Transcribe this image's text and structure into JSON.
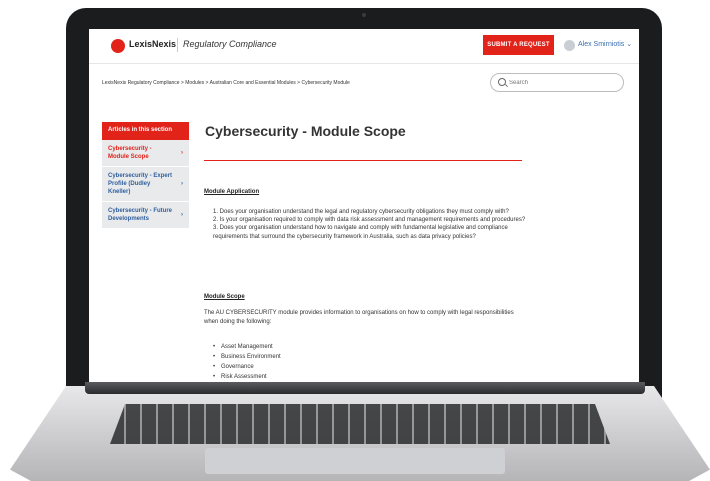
{
  "header": {
    "brand": "LexisNexis",
    "product": "Regulatory Compliance",
    "submit_button": "SUBMIT A REQUEST",
    "user_name": "Alex Smirniotis ⌄"
  },
  "breadcrumb": [
    "LexisNexis Regulatory Compliance",
    "Modules",
    "Australian Core and Essential Modules",
    "Cybersecurity Module"
  ],
  "breadcrumb_sep": " > ",
  "search": {
    "placeholder": "Search",
    "value": ""
  },
  "sidebar": {
    "header": "Articles in this section",
    "items": [
      {
        "label": "Cybersecurity - Module Scope",
        "active": true
      },
      {
        "label": "Cybersecurity - Expert Profile (Dudley Kneller)",
        "active": false
      },
      {
        "label": "Cybersecurity - Future Developments",
        "active": false
      }
    ],
    "chevron": "›"
  },
  "article": {
    "title": "Cybersecurity - Module Scope",
    "application_heading": "Module Application",
    "questions": [
      "1. Does your organisation understand the legal and regulatory cybersecurity obligations they must comply with?",
      "2. Is your organisation required to comply with data risk assessment and management requirements and procedures?",
      "3. Does your organisation understand how to navigate and comply with fundamental legislative and compliance requirements that surround the cybersecurity framework in Australia, such as data privacy policies?"
    ],
    "scope_heading": "Module Scope",
    "scope_paragraph": "The AU CYBERSECURITY module provides information to organisations on how to comply with legal responsibilities when doing the following:",
    "scope_items": [
      "Asset Management",
      "Business Environment",
      "Governance",
      "Risk Assessment"
    ]
  },
  "colors": {
    "accent": "#e2231a",
    "link": "#2f5f9e",
    "laptop": "#1b1c1e"
  }
}
